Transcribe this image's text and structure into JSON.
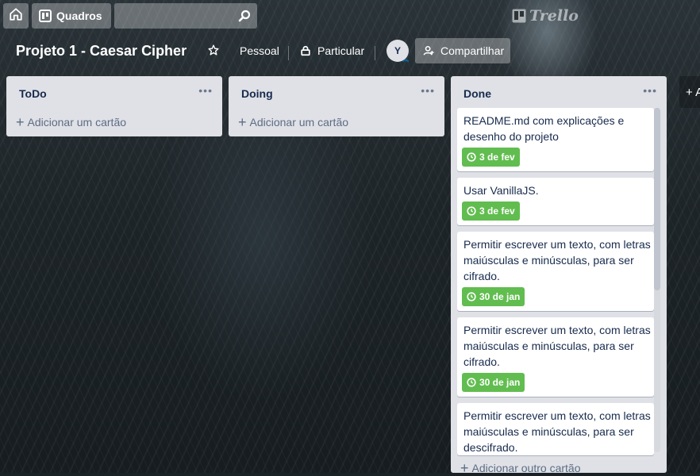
{
  "topbar": {
    "home_icon": "home-icon",
    "boards_label": "Quadros",
    "search_placeholder": "",
    "logo_text": "Trello"
  },
  "board": {
    "title": "Projeto 1 - Caesar Cipher",
    "team": "Pessoal",
    "visibility": "Particular",
    "avatar_initial": "Y",
    "share_label": "Compartilhar"
  },
  "lists": [
    {
      "title": "ToDo",
      "menu": "•••",
      "add_label": "Adicionar um cartão",
      "cards": []
    },
    {
      "title": "Doing",
      "menu": "•••",
      "add_label": "Adicionar um cartão",
      "cards": []
    },
    {
      "title": "Done",
      "menu": "•••",
      "add_label": "Adicionar outro cartão",
      "cards": [
        {
          "text": "README.md com explicações e desenho do projeto",
          "due": "3 de fev"
        },
        {
          "text": "Usar VanillaJS.",
          "due": "3 de fev"
        },
        {
          "text": "Permitir escrever um texto, com letras maiúsculas e minúsculas, para ser cifrado.",
          "due": "30 de jan"
        },
        {
          "text": "Permitir escrever um texto, com letras maiúsculas e minúsculas, para ser cifrado.",
          "due": "30 de jan"
        },
        {
          "text": "Permitir escrever um texto, com letras maiúsculas e minúsculas, para ser descifrado.",
          "due": ""
        }
      ]
    }
  ],
  "add_list_label": "+ A",
  "colors": {
    "due_badge": "#61bd4f",
    "list_bg": "#dfe1e6",
    "header_btn": "rgba(255,255,255,0.3)"
  }
}
